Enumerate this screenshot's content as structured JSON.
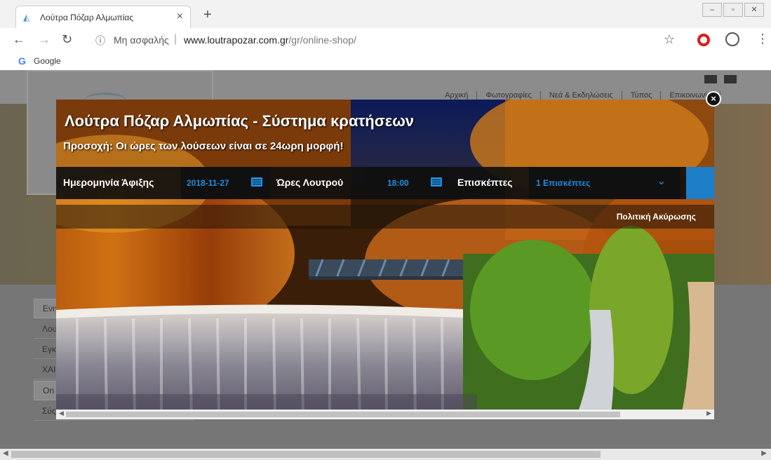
{
  "browser": {
    "tab_title": "Λούτρα Πόζαρ Αλμωπίας",
    "tab_close": "×",
    "new_tab": "+",
    "security_label": "Μη ασφαλής",
    "url_host": "www.loutrapozar.com.gr",
    "url_path": "/gr/online-shop/",
    "bookmark_label": "Google"
  },
  "site": {
    "nav": [
      "Αρχική",
      "Φωτογραφίες",
      "Νεά & Εκδηλώσεις",
      "Τύπος",
      "Επικοινωνία"
    ],
    "side_menu": [
      "Ενη",
      "Λου",
      "Εγκ",
      "ΧΑΙ",
      "On",
      "Σύς"
    ]
  },
  "modal": {
    "title": "Λούτρα Πόζαρ Αλμωπίας - Σύστημα κρατήσεων",
    "notice": "Προσοχή: Οι ώρες των λούσεων είναι σε 24ωρη μορφή!",
    "arrival_label": "Ημερομηνία Άφιξης",
    "arrival_value": "2018-11-27",
    "hours_label": "Ώρες Λουτρού",
    "hours_value": "18:00",
    "visitors_label": "Επισκέπτες",
    "visitors_value": "1 Επισκέπτες",
    "cancellation_link": "Πολιτική Ακύρωσης",
    "close": "×"
  },
  "colors": {
    "accent": "#1e8fe0",
    "form_bar": "#0f0f0f",
    "submit": "#1e7ec8"
  }
}
